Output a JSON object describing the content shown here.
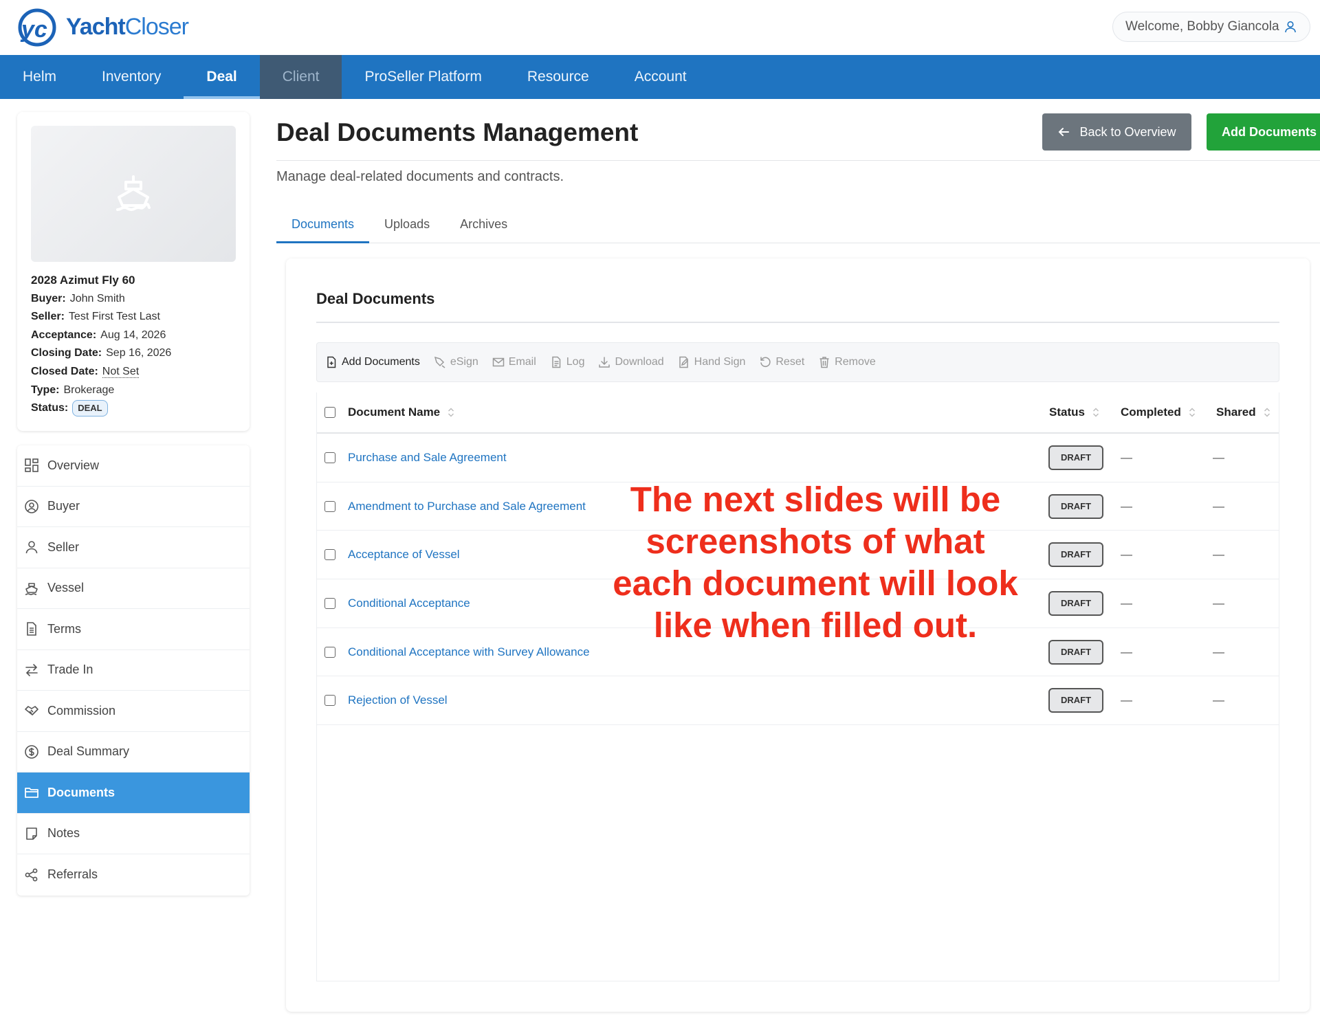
{
  "header": {
    "logo_bold": "Yacht",
    "logo_light": "Closer",
    "welcome": "Welcome, Bobby Giancola"
  },
  "nav": {
    "items": [
      {
        "label": "Helm"
      },
      {
        "label": "Inventory"
      },
      {
        "label": "Deal"
      },
      {
        "label": "Client"
      },
      {
        "label": "ProSeller Platform"
      },
      {
        "label": "Resource"
      },
      {
        "label": "Account"
      }
    ],
    "active": "Deal"
  },
  "vessel": {
    "title": "2028 Azimut Fly 60",
    "buyer_label": "Buyer:",
    "buyer": "John Smith",
    "seller_label": "Seller:",
    "seller": "Test First Test Last",
    "acceptance_label": "Acceptance:",
    "acceptance": "Aug 14, 2026",
    "closing_label": "Closing Date:",
    "closing": "Sep 16, 2026",
    "closed_label": "Closed Date:",
    "closed": "Not Set",
    "type_label": "Type:",
    "type": "Brokerage",
    "status_label": "Status:",
    "status": "DEAL"
  },
  "sidebar": {
    "items": [
      {
        "label": "Overview",
        "icon": "grid-icon"
      },
      {
        "label": "Buyer",
        "icon": "user-circle-icon"
      },
      {
        "label": "Seller",
        "icon": "user-icon"
      },
      {
        "label": "Vessel",
        "icon": "ship-icon"
      },
      {
        "label": "Terms",
        "icon": "document-icon"
      },
      {
        "label": "Trade In",
        "icon": "swap-icon"
      },
      {
        "label": "Commission",
        "icon": "handshake-icon"
      },
      {
        "label": "Deal Summary",
        "icon": "dollar-icon"
      },
      {
        "label": "Documents",
        "icon": "folder-icon"
      },
      {
        "label": "Notes",
        "icon": "note-icon"
      },
      {
        "label": "Referrals",
        "icon": "share-icon"
      }
    ],
    "active": "Documents"
  },
  "page": {
    "title": "Deal Documents Management",
    "subtitle": "Manage deal-related documents and contracts.",
    "back_button": "Back to Overview",
    "add_button": "Add Documents"
  },
  "tabs": [
    {
      "label": "Documents"
    },
    {
      "label": "Uploads"
    },
    {
      "label": "Archives"
    }
  ],
  "panel": {
    "title": "Deal Documents",
    "toolbar": [
      {
        "label": "Add Documents",
        "icon": "file-plus-icon"
      },
      {
        "label": "eSign",
        "icon": "pen-icon"
      },
      {
        "label": "Email",
        "icon": "mail-icon"
      },
      {
        "label": "Log",
        "icon": "log-icon"
      },
      {
        "label": "Download",
        "icon": "download-icon"
      },
      {
        "label": "Hand Sign",
        "icon": "edit-icon"
      },
      {
        "label": "Reset",
        "icon": "reset-icon"
      },
      {
        "label": "Remove",
        "icon": "trash-icon"
      }
    ],
    "columns": {
      "name": "Document Name",
      "status": "Status",
      "completed": "Completed",
      "shared": "Shared"
    },
    "rows": [
      {
        "name": "Purchase and Sale Agreement",
        "status": "DRAFT",
        "completed": "—",
        "shared": "—"
      },
      {
        "name": "Amendment to Purchase and Sale Agreement",
        "status": "DRAFT",
        "completed": "—",
        "shared": "—"
      },
      {
        "name": "Acceptance of Vessel",
        "status": "DRAFT",
        "completed": "—",
        "shared": "—"
      },
      {
        "name": "Conditional Acceptance",
        "status": "DRAFT",
        "completed": "—",
        "shared": "—"
      },
      {
        "name": "Conditional Acceptance with Survey Allowance",
        "status": "DRAFT",
        "completed": "—",
        "shared": "—"
      },
      {
        "name": "Rejection of Vessel",
        "status": "DRAFT",
        "completed": "—",
        "shared": "—"
      }
    ]
  },
  "overlay": {
    "text": "The next slides will be screenshots of what each document will look like when filled out."
  },
  "colors": {
    "nav_blue": "#1f74c1",
    "active_side": "#3a96de",
    "add_green": "#22a33a",
    "overlay_red": "#ee2e1c"
  }
}
